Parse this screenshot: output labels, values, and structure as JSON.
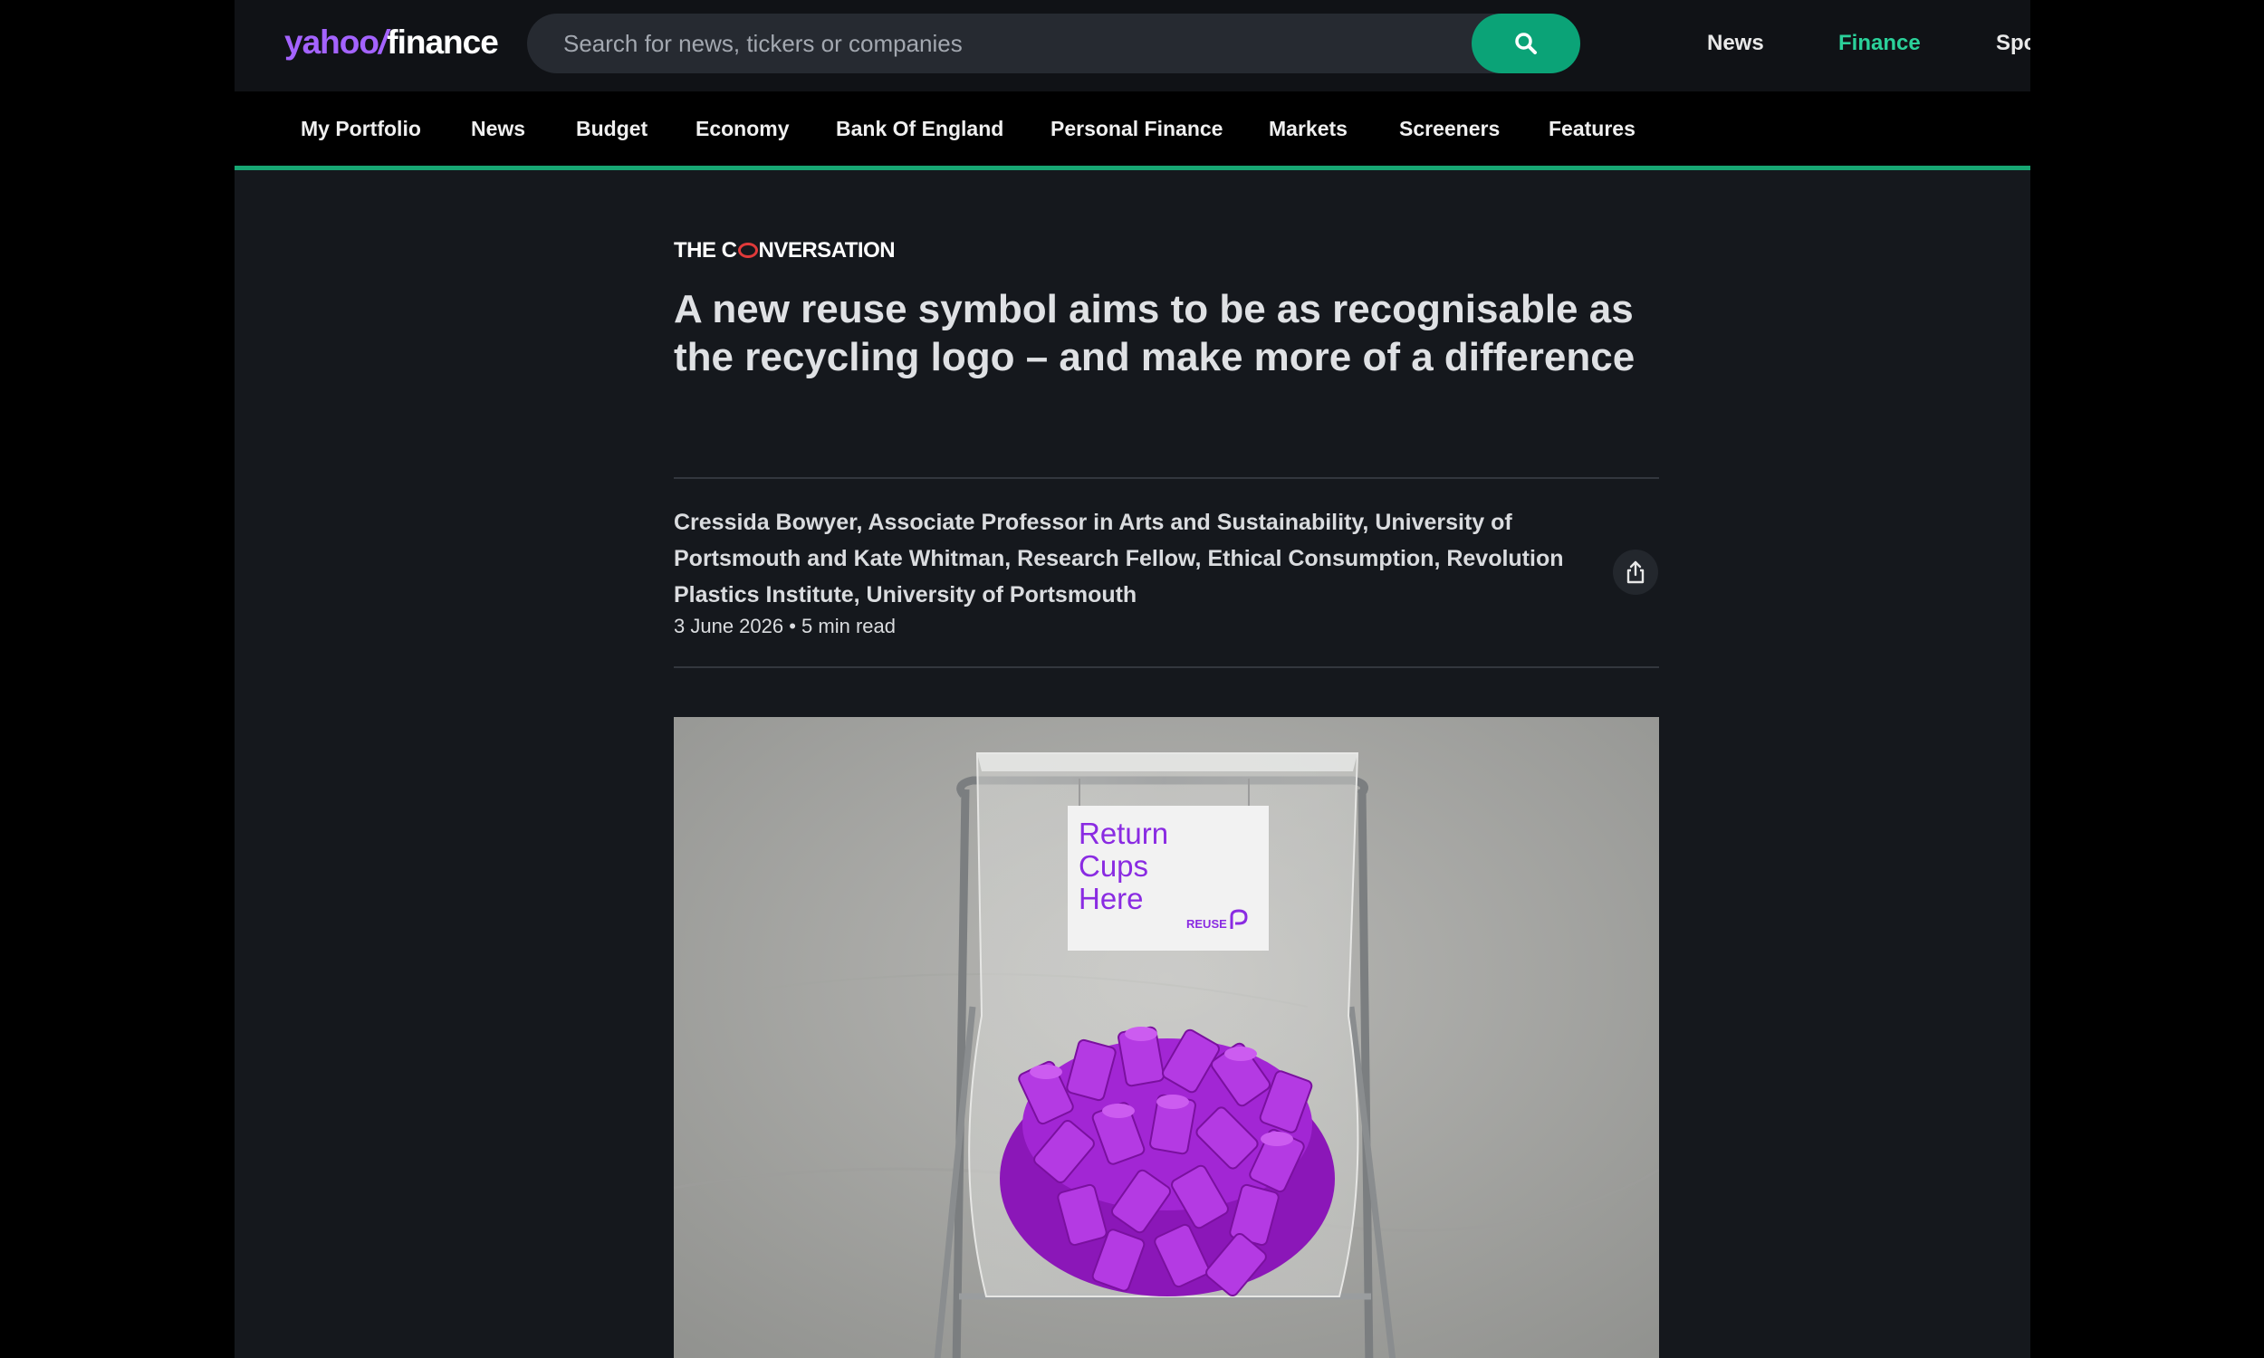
{
  "header": {
    "logo": {
      "yahoo": "yahoo",
      "slash": "/",
      "finance": "finance"
    },
    "search": {
      "placeholder": "Search for news, tickers or companies",
      "button_icon": "search-icon"
    },
    "nav": [
      {
        "label": "News",
        "active": false
      },
      {
        "label": "Finance",
        "active": true
      },
      {
        "label": "Spo",
        "active": false
      }
    ]
  },
  "subnav": {
    "items": [
      "My Portfolio",
      "News",
      "Budget",
      "Economy",
      "Bank Of England",
      "Personal Finance",
      "Markets",
      "Screeners",
      "Features"
    ]
  },
  "article": {
    "source": {
      "before": "THE C",
      "after": "NVERSATION"
    },
    "headline": "A new reuse symbol aims to be as recognisable as the recycling logo – and make more of a difference",
    "byline": "Cressida Bowyer, Associate Professor in Arts and Sustainability, University of Portsmouth and Kate Whitman, Research Fellow, Ethical Consumption, Revolution Plastics Institute, University of Portsmouth",
    "meta": "3 June 2026 • 5 min read",
    "share_icon": "share-icon",
    "image": {
      "sign_lines": [
        "Return",
        "Cups",
        "Here"
      ],
      "sign_brand": "REUSE"
    }
  },
  "colors": {
    "accent_green": "#0ba377",
    "active_nav": "#2bd19a",
    "logo_purple": "#a463ff",
    "background": "#15181d",
    "cups_purple": "#a020d0"
  }
}
